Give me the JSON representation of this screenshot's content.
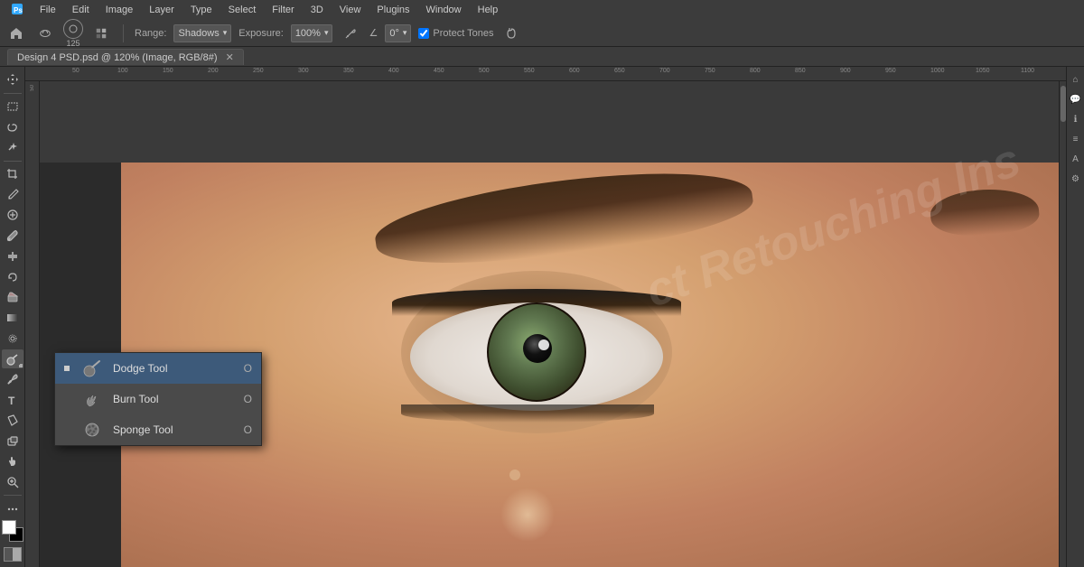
{
  "app": {
    "title": "Adobe Photoshop"
  },
  "menubar": {
    "items": [
      "PS",
      "File",
      "Edit",
      "Image",
      "Layer",
      "Type",
      "Select",
      "Filter",
      "3D",
      "View",
      "Plugins",
      "Window",
      "Help"
    ]
  },
  "options_bar": {
    "range_label": "Range:",
    "range_value": "Shadows",
    "exposure_label": "Exposure:",
    "exposure_value": "100%",
    "angle_label": "∠",
    "angle_value": "0°",
    "protect_tones_label": "Protect Tones",
    "brush_size": "125"
  },
  "document": {
    "tab_label": "Design 4 PSD.psd @ 120% (Image, RGB/8#)"
  },
  "flyout": {
    "title": "Tool Flyout",
    "items": [
      {
        "id": "dodge",
        "label": "Dodge Tool",
        "shortcut": "O",
        "selected": true
      },
      {
        "id": "burn",
        "label": "Burn Tool",
        "shortcut": "O",
        "selected": false
      },
      {
        "id": "sponge",
        "label": "Sponge Tool",
        "shortcut": "O",
        "selected": false
      }
    ]
  },
  "watermark": {
    "text": "ct Retouching Ins"
  },
  "ruler": {
    "ticks": [
      "50",
      "100",
      "150",
      "200",
      "250",
      "300",
      "350",
      "400",
      "450",
      "500",
      "550",
      "600",
      "650",
      "700",
      "750",
      "800",
      "850",
      "900",
      "950",
      "1000",
      "1050",
      "1100"
    ]
  }
}
